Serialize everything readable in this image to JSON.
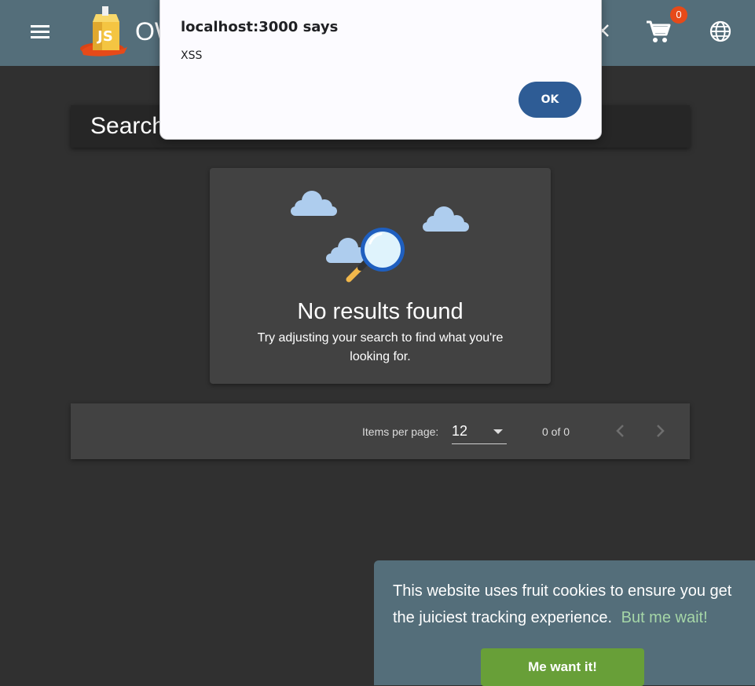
{
  "toolbar": {
    "app_title": "OWASP Juice Shop",
    "cart_count": "0",
    "menu_icon": "menu-icon",
    "close_icon": "close-icon",
    "cart_icon": "shopping-cart-icon",
    "language_icon": "globe-icon"
  },
  "search_results": {
    "heading": "Search Results"
  },
  "no_results": {
    "title": "No results found",
    "message": "Try adjusting your search to find what you're looking for."
  },
  "paginator": {
    "items_per_page_label": "Items per page:",
    "items_per_page_value": "12",
    "range_label": "0 of 0"
  },
  "alert": {
    "title": "localhost:3000 says",
    "message": "XSS",
    "ok_label": "OK"
  },
  "cookie_banner": {
    "message": "This website uses fruit cookies to ensure you get the juiciest tracking experience.",
    "link_label": "But me wait!",
    "accept_label": "Me want it!"
  },
  "colors": {
    "toolbar": "#546e7a",
    "background": "#303030",
    "card": "#424242",
    "accent_green": "#689f38",
    "badge": "#e64a19",
    "dialog_button": "#2e5c95"
  }
}
